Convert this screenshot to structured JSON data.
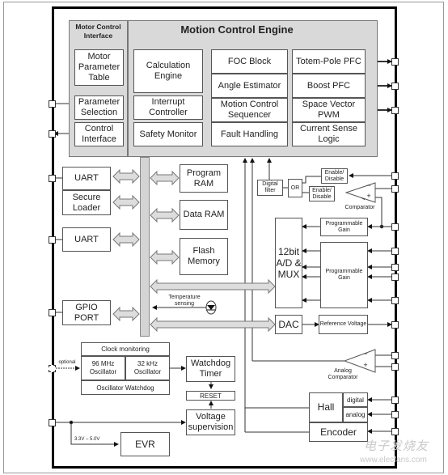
{
  "diagram": {
    "motor_control_interface": {
      "title": "Motor Control Interface",
      "blocks": [
        "Motor Parameter Table",
        "Parameter Selection",
        "Control Interface"
      ]
    },
    "motion_control_engine": {
      "title": "Motion Control Engine",
      "col1": [
        "Calculation Engine",
        "Interrupt Controller",
        "Safety Monitor"
      ],
      "col2": [
        "FOC Block",
        "Angle Estimator",
        "Motion Control Sequencer",
        "Fault Handling"
      ],
      "col3": [
        "Totem-Pole PFC",
        "Boost PFC",
        "Space Vector PWM",
        "Current Sense Logic"
      ]
    },
    "peripherals_left": [
      "UART",
      "Secure Loader",
      "UART",
      "GPIO PORT"
    ],
    "memories": [
      "Program RAM",
      "Data RAM",
      "Flash Memory"
    ],
    "analog": {
      "digital_filter": "Digital filter",
      "or_gate": "OR",
      "enable_disable_1": "Enable/ Disable",
      "enable_disable_2": "Enable/ Disable",
      "comparator": "Comparator",
      "comparator_minus": "−",
      "comparator_plus": "+",
      "prog_gain_1": "Programmable Gain",
      "prog_gain_2": "Programmable Gain",
      "adc": "12bit A/D & MUX",
      "dac": "DAC",
      "reference_voltage": "Reference Voltage",
      "analog_comparator": "Analog Comparator",
      "analog_minus": "−",
      "analog_plus": "+",
      "temperature_sensing": "Temperature sensing"
    },
    "clock": {
      "title": "Clock monitoring",
      "osc96": "96 MHz Oscillator",
      "osc32": "32 kHz Oscillator",
      "watchdog": "Oscillator Watchdog",
      "optional": "optional"
    },
    "watchdog_timer": "Watchdog Timer",
    "reset": "RESET",
    "voltage_supervision": "Voltage supervision",
    "evr": "EVR",
    "supply_range": "3.3V – 5.0V",
    "sensors": {
      "hall": "Hall",
      "digital": "digital",
      "analog": "analog",
      "encoder": "Encoder"
    },
    "watermark": {
      "cn": "电子发烧友",
      "url": "www.elecfans.com"
    }
  }
}
